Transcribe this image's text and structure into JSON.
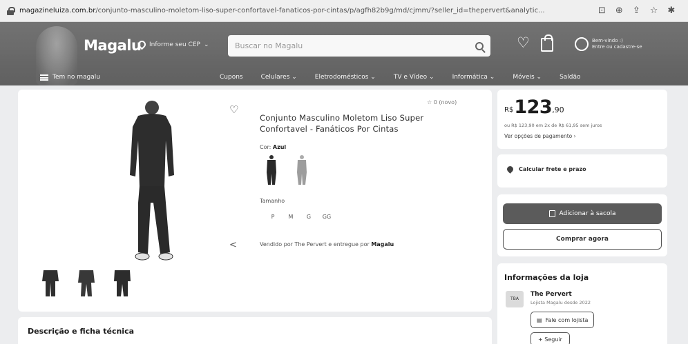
{
  "browser": {
    "url_host": "magazineluiza.com.br",
    "url_path": "/conjunto-masculino-moletom-liso-super-confortavel-fanaticos-por-cintas/p/agfh82b9g/md/cjmm/?seller_id=thepervert&analytic..."
  },
  "header": {
    "logo": "Magalu",
    "cep_label": "Informe seu CEP",
    "search_placeholder": "Buscar no Magalu",
    "user_line1": "Bem-vindo :)",
    "user_line2": "Entre ou cadastre-se",
    "menu_label": "Tem no magalu",
    "nav": [
      "Cupons",
      "Celulares ⌄",
      "Eletrodomésticos ⌄",
      "TV e Vídeo ⌄",
      "Informática ⌄",
      "Móveis ⌄",
      "Saldão"
    ]
  },
  "product": {
    "title": "Conjunto Masculino Moletom Liso Super Confortavel - Fanáticos Por Cintas",
    "rating": "0 (novo)",
    "color_label": "Cor: ",
    "color_value": "Azul",
    "size_label": "Tamanho",
    "sizes": [
      "P",
      "M",
      "G",
      "GG"
    ],
    "seller_prefix": "Vendido por The Pervert e entregue por ",
    "seller_brand": "Magalu"
  },
  "description": {
    "title": "Descrição e ficha técnica"
  },
  "pricing": {
    "currency": "R$",
    "whole": "123",
    "cents": ",90",
    "installment": "ou R$ 123,90 em 2x de R$ 61,95 sem juros",
    "payment_options": "Ver opções de pagamento"
  },
  "shipping": {
    "label": "Calcular frete e prazo"
  },
  "actions": {
    "add_to_bag": "Adicionar à sacola",
    "buy_now": "Comprar agora"
  },
  "store": {
    "title": "Informações da loja",
    "logo_text": "TBA",
    "name": "The Pervert",
    "since": "Lojista Magalu desde 2022",
    "chat": "Fale com lojista",
    "follow": "+ Seguir"
  },
  "colors": {
    "header_bg": "#65696f",
    "add_button": "#5a5d62"
  }
}
